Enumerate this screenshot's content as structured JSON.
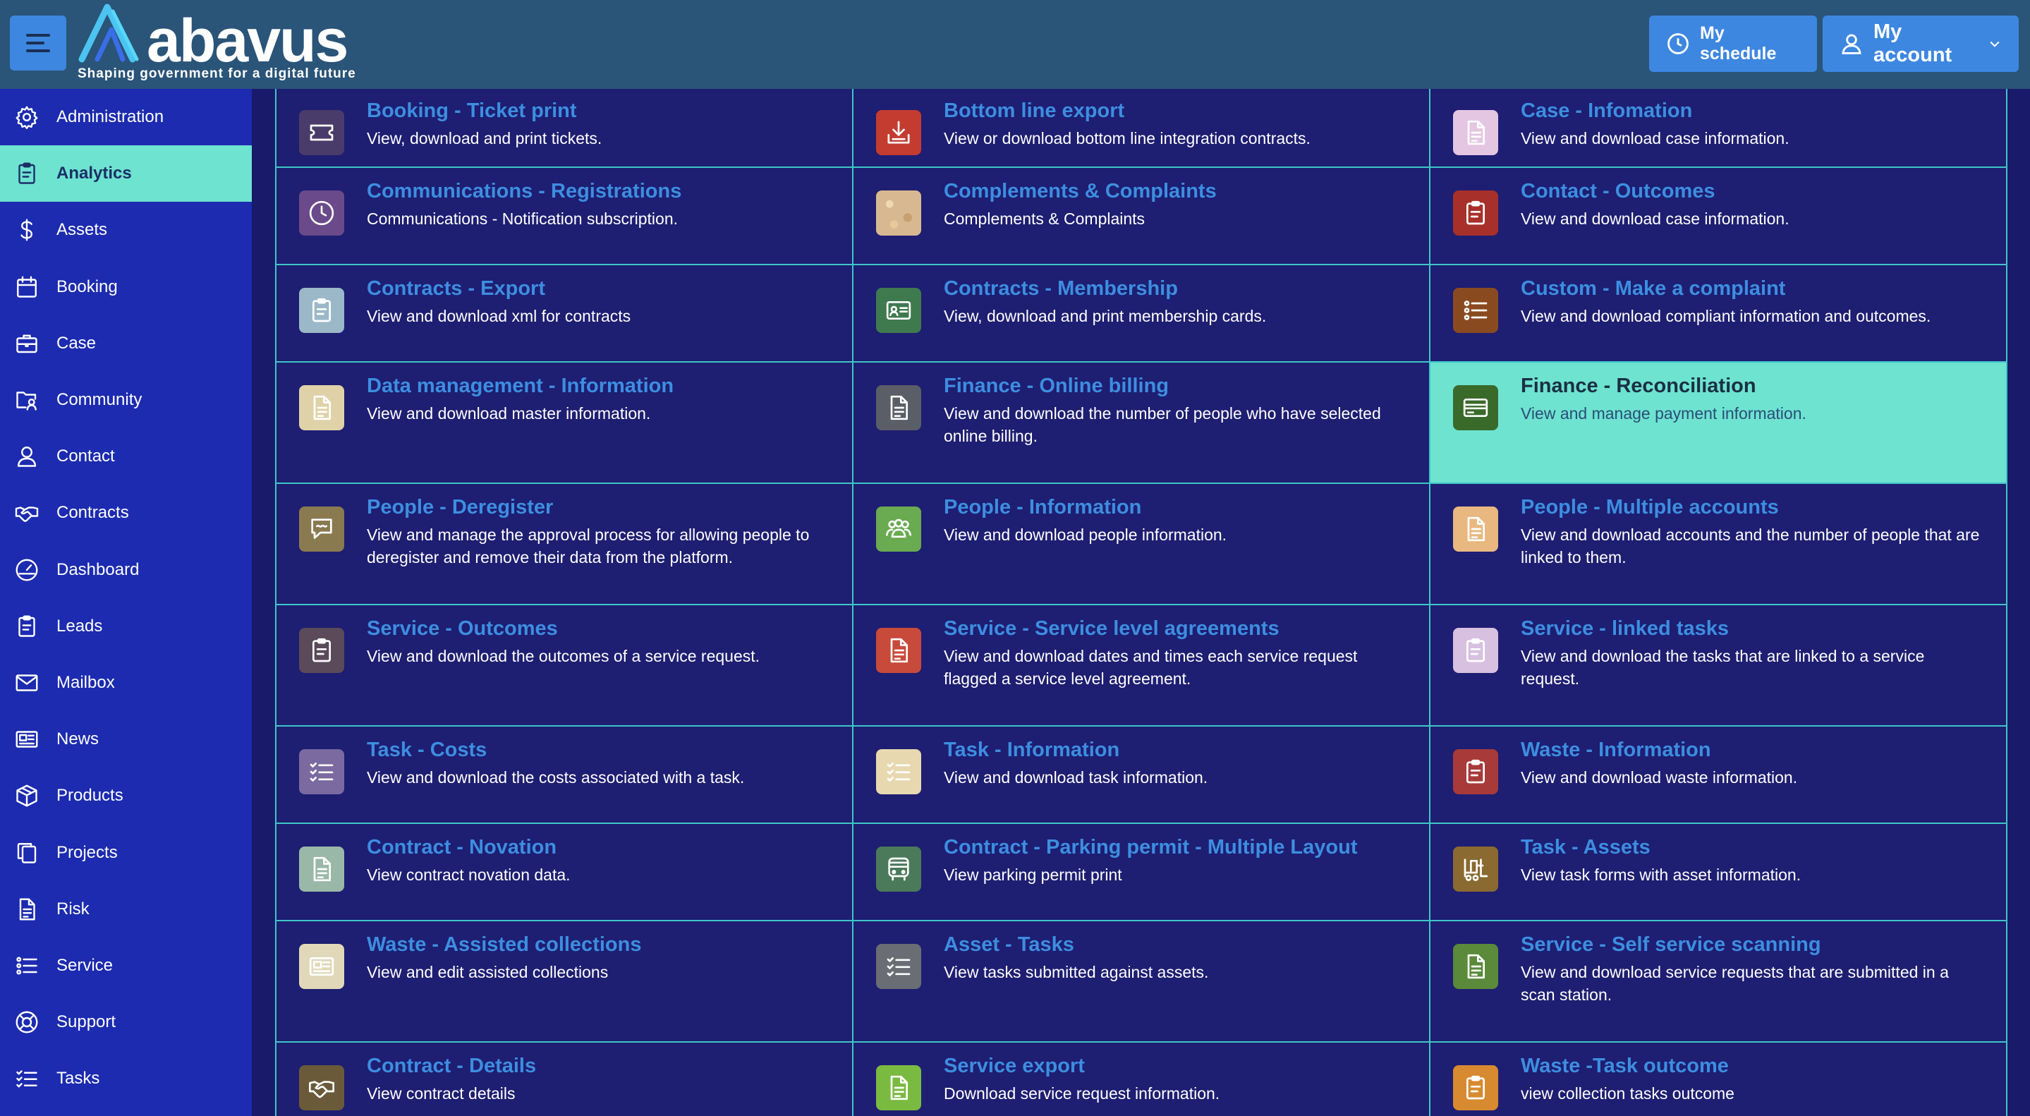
{
  "header": {
    "brand": "abavus",
    "tagline": "Shaping government for a digital future",
    "my_schedule": "My schedule",
    "my_account": "My account"
  },
  "sidebar": {
    "items": [
      {
        "label": "Administration",
        "icon": "gear-icon"
      },
      {
        "label": "Analytics",
        "icon": "clipboard-icon",
        "active": true
      },
      {
        "label": "Assets",
        "icon": "dollar-icon"
      },
      {
        "label": "Booking",
        "icon": "calendar-icon"
      },
      {
        "label": "Case",
        "icon": "briefcase-icon"
      },
      {
        "label": "Community",
        "icon": "people-folder-icon"
      },
      {
        "label": "Contact",
        "icon": "person-icon"
      },
      {
        "label": "Contracts",
        "icon": "handshake-icon"
      },
      {
        "label": "Dashboard",
        "icon": "gauge-icon"
      },
      {
        "label": "Leads",
        "icon": "clipboard-icon"
      },
      {
        "label": "Mailbox",
        "icon": "envelope-icon"
      },
      {
        "label": "News",
        "icon": "newspaper-icon"
      },
      {
        "label": "Products",
        "icon": "box-icon"
      },
      {
        "label": "Projects",
        "icon": "copy-icon"
      },
      {
        "label": "Risk",
        "icon": "document-icon"
      },
      {
        "label": "Service",
        "icon": "list-icon"
      },
      {
        "label": "Support",
        "icon": "lifebuoy-icon"
      },
      {
        "label": "Tasks",
        "icon": "checklist-icon"
      }
    ]
  },
  "colors": {
    "header_bg": "#2a5478",
    "sidebar_bg": "#1c2bb0",
    "active_bg": "#6ee3d0",
    "grid_bg": "#1e1e72",
    "border": "#3ec6c8",
    "title": "#3d8ee0",
    "button": "#3d87e0"
  },
  "rows": [
    [
      {
        "title": "Booking - Ticket print",
        "desc": "View, download and print tickets.",
        "icon": "ticket-icon",
        "color": "#4a3c6a"
      },
      {
        "title": "Bottom line export",
        "desc": "View or download bottom line integration contracts.",
        "icon": "download-icon",
        "color": "#c43c30"
      },
      {
        "title": "Case - Infomation",
        "desc": "View and download case information.",
        "icon": "document-icon",
        "color": "#e4c6e2"
      }
    ],
    [
      {
        "title": "Communications - Registrations",
        "desc": "Communications - Notification subscription.",
        "icon": "clock-icon",
        "color": "#6a4a8a"
      },
      {
        "title": "Complements & Complaints",
        "desc": "Complements & Complaints",
        "icon": "",
        "color": "#d8b890"
      },
      {
        "title": "Contact - Outcomes",
        "desc": "View and download case information.",
        "icon": "clipboard-icon",
        "color": "#a8302a"
      }
    ],
    [
      {
        "title": "Contracts - Export",
        "desc": "View and download xml for contracts",
        "icon": "clipboard-icon",
        "color": "#9ab8c8"
      },
      {
        "title": "Contracts - Membership",
        "desc": "View, download and print membership cards.",
        "icon": "id-card-icon",
        "color": "#3f7a4f"
      },
      {
        "title": "Custom - Make a complaint",
        "desc": "View and download compliant information and outcomes.",
        "icon": "list-icon",
        "color": "#8a4a20"
      }
    ],
    [
      {
        "title": "Data management - Information",
        "desc": "View and download master information.",
        "icon": "document-icon",
        "color": "#e0d2a8"
      },
      {
        "title": "Finance - Online billing",
        "desc": "View and download the number of people who have selected online billing.",
        "icon": "document-icon",
        "color": "#5a5e66"
      },
      {
        "title": "Finance - Reconciliation",
        "desc": "View and manage payment information.",
        "icon": "card-icon",
        "color": "#3a6a2a",
        "highlight": true
      }
    ],
    [
      {
        "title": "People - Deregister",
        "desc": "View and manage the approval process for allowing people to deregister and remove their data from the platform.",
        "icon": "chat-icon",
        "color": "#8a7a50"
      },
      {
        "title": "People - Information",
        "desc": "View and download people information.",
        "icon": "people-icon",
        "color": "#6aaa50"
      },
      {
        "title": "People - Multiple accounts",
        "desc": "View and download accounts and the number of people that are linked to them.",
        "icon": "document-icon",
        "color": "#e8b880"
      }
    ],
    [
      {
        "title": "Service - Outcomes",
        "desc": "View and download the outcomes of a service request.",
        "icon": "clipboard-icon",
        "color": "#5a4a5a"
      },
      {
        "title": "Service - Service level agreements",
        "desc": "View and download dates and times each service request flagged a service level agreement.",
        "icon": "document-icon",
        "color": "#c84a3a"
      },
      {
        "title": "Service - linked tasks",
        "desc": "View and download the tasks that are linked to a service request.",
        "icon": "clipboard-icon",
        "color": "#d8c0e0"
      }
    ],
    [
      {
        "title": "Task - Costs",
        "desc": "View and download the costs associated with a task.",
        "icon": "checklist-icon",
        "color": "#7a6aa0"
      },
      {
        "title": "Task - Information",
        "desc": "View and download task information.",
        "icon": "checklist-icon",
        "color": "#e8d8b0"
      },
      {
        "title": "Waste - Information",
        "desc": "View and download waste information.",
        "icon": "clipboard-icon",
        "color": "#a83a3a"
      }
    ],
    [
      {
        "title": "Contract - Novation",
        "desc": "View contract novation data.",
        "icon": "document-icon",
        "color": "#9ab8a8"
      },
      {
        "title": "Contract - Parking permit - Multiple Layout",
        "desc": "View parking permit print",
        "icon": "bus-icon",
        "color": "#4a7a5a"
      },
      {
        "title": "Task - Assets",
        "desc": "View task forms with asset information.",
        "icon": "forklift-icon",
        "color": "#8a6a30"
      }
    ],
    [
      {
        "title": "Waste - Assisted collections",
        "desc": "View and edit assisted collections",
        "icon": "newspaper-icon",
        "color": "#e0d8b8"
      },
      {
        "title": "Asset - Tasks",
        "desc": "View tasks submitted against assets.",
        "icon": "checklist-icon",
        "color": "#6a6e74"
      },
      {
        "title": "Service - Self service scanning",
        "desc": "View and download service requests that are submitted in a scan station.",
        "icon": "document-icon",
        "color": "#5a8a3a"
      }
    ],
    [
      {
        "title": "Contract - Details",
        "desc": "View contract details",
        "icon": "handshake-icon",
        "color": "#6a5a3a"
      },
      {
        "title": "Service export",
        "desc": "Download service request information.",
        "icon": "document-icon",
        "color": "#7aba40"
      },
      {
        "title": "Waste -Task outcome",
        "desc": "view collection tasks outcome",
        "icon": "clipboard-icon",
        "color": "#d88a30"
      }
    ]
  ]
}
